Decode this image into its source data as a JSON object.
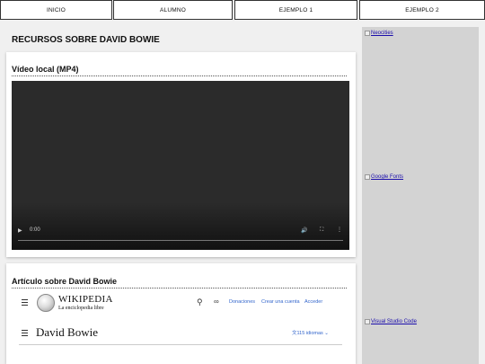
{
  "nav": [
    "INICIO",
    "ALUMNO",
    "EJEMPLO 1",
    "EJEMPLO 2"
  ],
  "page_title": "RECURSOS SOBRE DAVID BOWIE",
  "video_section": {
    "title": "Vídeo local (MP4)",
    "time": "0:00"
  },
  "article_section": {
    "title": "Artículo sobre David Bowie",
    "wiki": {
      "wordmark": "WIKIPEDIA",
      "tagline": "La enciclopedia libre",
      "links": [
        "Donaciones",
        "Crear una cuenta",
        "Acceder"
      ],
      "article_title": "David Bowie",
      "languages": "115 idiomas"
    }
  },
  "sidebar_links": [
    "Neocities",
    "Google Fonts",
    "Visual Studio Code"
  ]
}
